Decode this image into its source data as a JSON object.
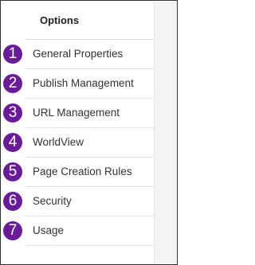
{
  "panel": {
    "title": "Options"
  },
  "theme": {
    "badge_color": "#6a1b9a",
    "badge_text_color": "#ffffff"
  },
  "menu": {
    "items": [
      {
        "number": "1",
        "label": "General Properties"
      },
      {
        "number": "2",
        "label": "Publish Management"
      },
      {
        "number": "3",
        "label": "URL Management"
      },
      {
        "number": "4",
        "label": "WorldView"
      },
      {
        "number": "5",
        "label": "Page Creation Rules"
      },
      {
        "number": "6",
        "label": "Security"
      },
      {
        "number": "7",
        "label": "Usage"
      }
    ]
  }
}
